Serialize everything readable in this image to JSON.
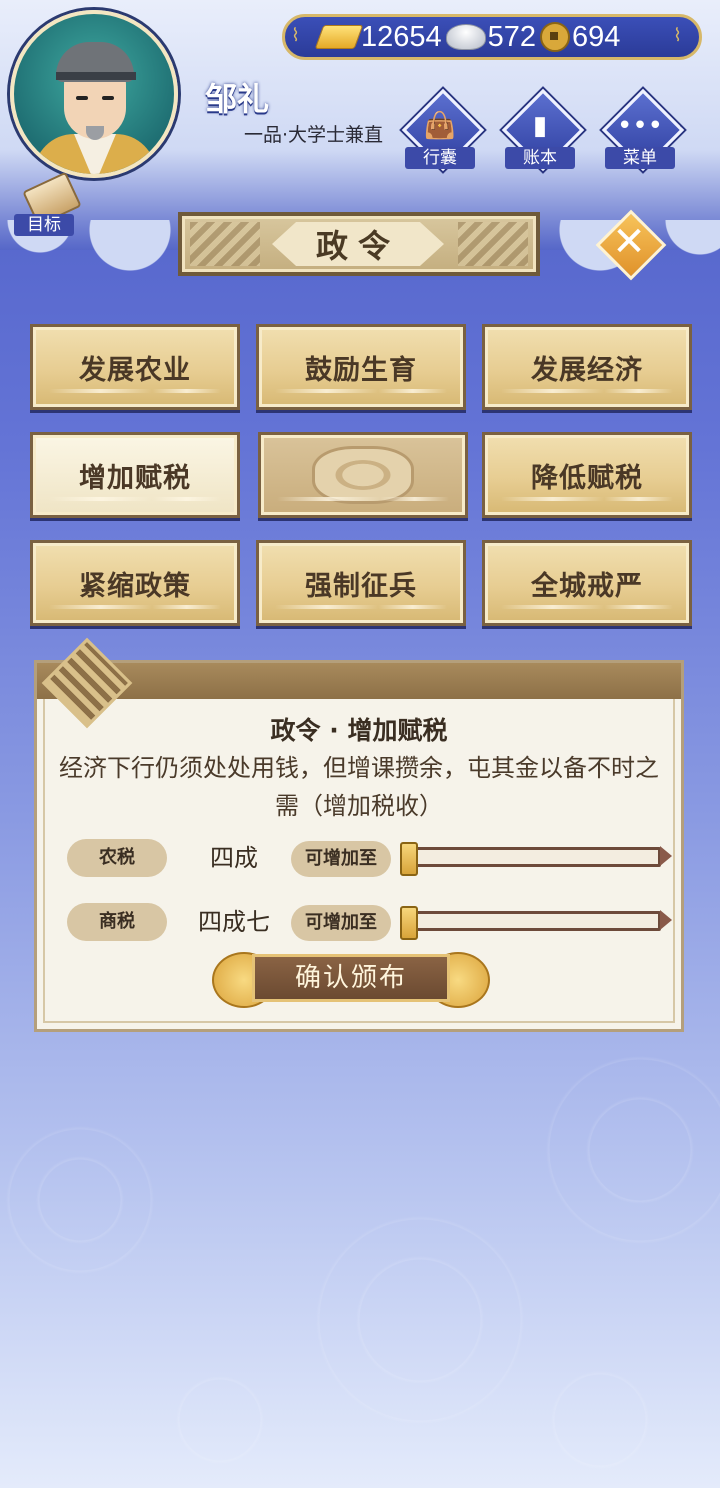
{
  "profile": {
    "name": "邹礼",
    "title": "一品·大学士兼直"
  },
  "currency": {
    "gold": "12654",
    "silver": "572",
    "coins": "694",
    "gold_icon": "gold-ingot-icon",
    "silver_icon": "silver-ingot-icon",
    "coin_icon": "copper-coin-icon"
  },
  "top_buttons": [
    {
      "label": "行囊",
      "icon": "bag-icon"
    },
    {
      "label": "账本",
      "icon": "ledger-icon"
    },
    {
      "label": "菜单",
      "icon": "menu-dots-icon"
    }
  ],
  "goal": {
    "label": "目标"
  },
  "header": {
    "title": "政令"
  },
  "policies": [
    {
      "label": "发展农业"
    },
    {
      "label": "鼓励生育"
    },
    {
      "label": "发展经济"
    },
    {
      "label": "增加赋税",
      "selected": true
    },
    {
      "label": "",
      "locked": true
    },
    {
      "label": "降低赋税"
    },
    {
      "label": "紧缩政策"
    },
    {
      "label": "强制征兵"
    },
    {
      "label": "全城戒严"
    }
  ],
  "detail": {
    "title": "政令 · 增加赋税",
    "description": "经济下行仍须处处用钱，但增课攒余，屯其金以备不时之需（增加税收）",
    "rows": [
      {
        "tag": "农税",
        "value": "四成",
        "action": "可增加至",
        "level": 0
      },
      {
        "tag": "商税",
        "value": "四成七",
        "action": "可增加至",
        "level": 0
      }
    ],
    "confirm_label": "确认颁布"
  },
  "colors": {
    "accent_gold": "#d7b869",
    "panel_bg": "#f6f3ea",
    "bg_blue": "#4a5bc4"
  }
}
